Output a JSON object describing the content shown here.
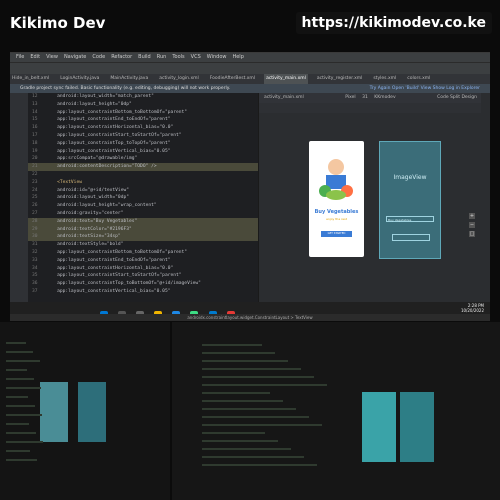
{
  "brand": {
    "name": "Kikimo Dev",
    "url": "https://kikimodev.co.ke"
  },
  "ide": {
    "menu": [
      "File",
      "Edit",
      "View",
      "Navigate",
      "Code",
      "Refactor",
      "Build",
      "Run",
      "Tools",
      "VCS",
      "Window",
      "Help"
    ],
    "tabs": [
      "Hide_in_belt.xml",
      "LoginActivity.java",
      "MainActivity.java",
      "activity_login.xml",
      "FoodieAfterBest.xml",
      "activity_main.xml",
      "activity_register.xml",
      "styles.xml",
      "colors.xml"
    ],
    "active_tab": "activity_main.xml",
    "notice": "Gradle project sync failed. Basic functionality (e.g. editing, debugging) will not work properly.",
    "notice_links": "Try Again   Open 'Build' View   Show Log in Explorer",
    "design_tab": "activity_main.xml",
    "device": "Pixel",
    "api": "31",
    "theme": "KKmodev",
    "design_modes": "Code  Split  Design",
    "phone": {
      "title": "Buy Vegetables",
      "subtitle": "enjoy the rest",
      "button": "GET STARTED"
    },
    "blueprint": {
      "label": "ImageView",
      "edit": "Buy Vegetables"
    },
    "bottom_tools": [
      "Version Control",
      "Run",
      "Debug",
      "TODO",
      "Problems",
      "Terminal",
      "Logcat",
      "App Inspection",
      "Build",
      "Profiler"
    ],
    "bottom_right": "Event Log   Layout Inspector",
    "breadcrumb": "androidx.constraintlayout.widget.ConstraintLayout   >   TextView",
    "clock_time": "2:28 PM",
    "clock_date": "10/20/2022"
  },
  "code_lines": [
    {
      "n": "12",
      "t": "android:layout_width=\"match_parent\""
    },
    {
      "n": "13",
      "t": "android:layout_height=\"0dp\""
    },
    {
      "n": "14",
      "t": "app:layout_constraintBottom_toBottomOf=\"parent\""
    },
    {
      "n": "15",
      "t": "app:layout_constraintEnd_toEndOf=\"parent\""
    },
    {
      "n": "16",
      "t": "app:layout_constraintHorizontal_bias=\"0.0\""
    },
    {
      "n": "17",
      "t": "app:layout_constraintStart_toStartOf=\"parent\""
    },
    {
      "n": "18",
      "t": "app:layout_constraintTop_toTopOf=\"parent\""
    },
    {
      "n": "19",
      "t": "app:layout_constraintVertical_bias=\"0.05\""
    },
    {
      "n": "20",
      "t": "app:srcCompat=\"@drawable/img\""
    },
    {
      "n": "21",
      "t": "android:contentDescription=\"TODO\" />"
    },
    {
      "n": "22",
      "t": ""
    },
    {
      "n": "23",
      "t": "<TextView"
    },
    {
      "n": "24",
      "t": "android:id=\"@+id/textView\""
    },
    {
      "n": "25",
      "t": "android:layout_width=\"0dp\""
    },
    {
      "n": "26",
      "t": "android:layout_height=\"wrap_content\""
    },
    {
      "n": "27",
      "t": "android:gravity=\"center\""
    },
    {
      "n": "28",
      "t": "android:text=\"Buy Vegetables\""
    },
    {
      "n": "29",
      "t": "android:textColor=\"#2196F3\""
    },
    {
      "n": "30",
      "t": "android:textSize=\"34sp\""
    },
    {
      "n": "31",
      "t": "android:textStyle=\"bold\""
    },
    {
      "n": "32",
      "t": "app:layout_constraintBottom_toBottomOf=\"parent\""
    },
    {
      "n": "33",
      "t": "app:layout_constraintEnd_toEndOf=\"parent\""
    },
    {
      "n": "34",
      "t": "app:layout_constraintHorizontal_bias=\"0.0\""
    },
    {
      "n": "35",
      "t": "app:layout_constraintStart_toStartOf=\"parent\""
    },
    {
      "n": "36",
      "t": "app:layout_constraintTop_toBottomOf=\"@+id/imageView\""
    },
    {
      "n": "37",
      "t": "app:layout_constraintVertical_bias=\"0.05\""
    }
  ],
  "colors": {
    "accent": "#3a7bd5",
    "blueprint": "#3b6d79",
    "ide_bg": "#1e1f22"
  }
}
